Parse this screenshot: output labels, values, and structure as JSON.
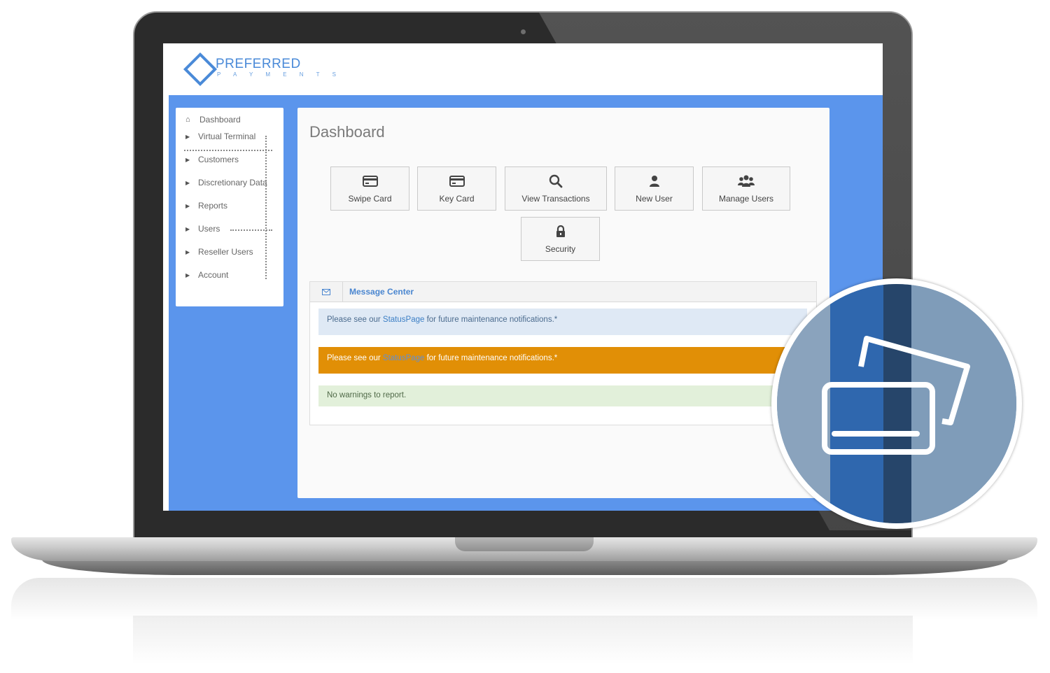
{
  "brand": {
    "name": "PREFERRED",
    "sub": "P A Y M E N T S",
    "color": "#4a8ad8"
  },
  "sidebar": {
    "items": [
      {
        "label": "Dashboard",
        "icon": "home-icon"
      },
      {
        "label": "Virtual Terminal",
        "icon": "caret-right-icon"
      },
      {
        "label": "Customers",
        "icon": "caret-right-icon"
      },
      {
        "label": "Discretionary Data",
        "icon": "caret-right-icon"
      },
      {
        "label": "Reports",
        "icon": "caret-right-icon"
      },
      {
        "label": "Users",
        "icon": "caret-right-icon"
      },
      {
        "label": "Reseller Users",
        "icon": "caret-right-icon"
      },
      {
        "label": "Account",
        "icon": "caret-right-icon"
      }
    ]
  },
  "main": {
    "title": "Dashboard",
    "tiles": [
      {
        "label": "Swipe Card",
        "icon": "credit-card-icon"
      },
      {
        "label": "Key Card",
        "icon": "credit-card-icon"
      },
      {
        "label": "View Transactions",
        "icon": "search-icon"
      },
      {
        "label": "New User",
        "icon": "user-icon"
      },
      {
        "label": "Manage Users",
        "icon": "users-icon"
      },
      {
        "label": "Security",
        "icon": "lock-icon"
      }
    ]
  },
  "messages": {
    "title": "Message Center",
    "info_prefix": "Please see our ",
    "info_link": "StatusPage",
    "info_suffix": " for future maintenance notifications.*",
    "warn_prefix": "Please see our ",
    "warn_link": "StatusPage",
    "warn_suffix": " for future maintenance notifications.*",
    "ok_text": "No warnings to report."
  },
  "colors": {
    "background_blue": "#5b95ec",
    "warning": "#e18f06",
    "info_bg": "#dfe9f5",
    "success_bg": "#e2f0da",
    "feature_dark_blue": "#2f67ae"
  },
  "feature_icon": "card-swipe-icon"
}
